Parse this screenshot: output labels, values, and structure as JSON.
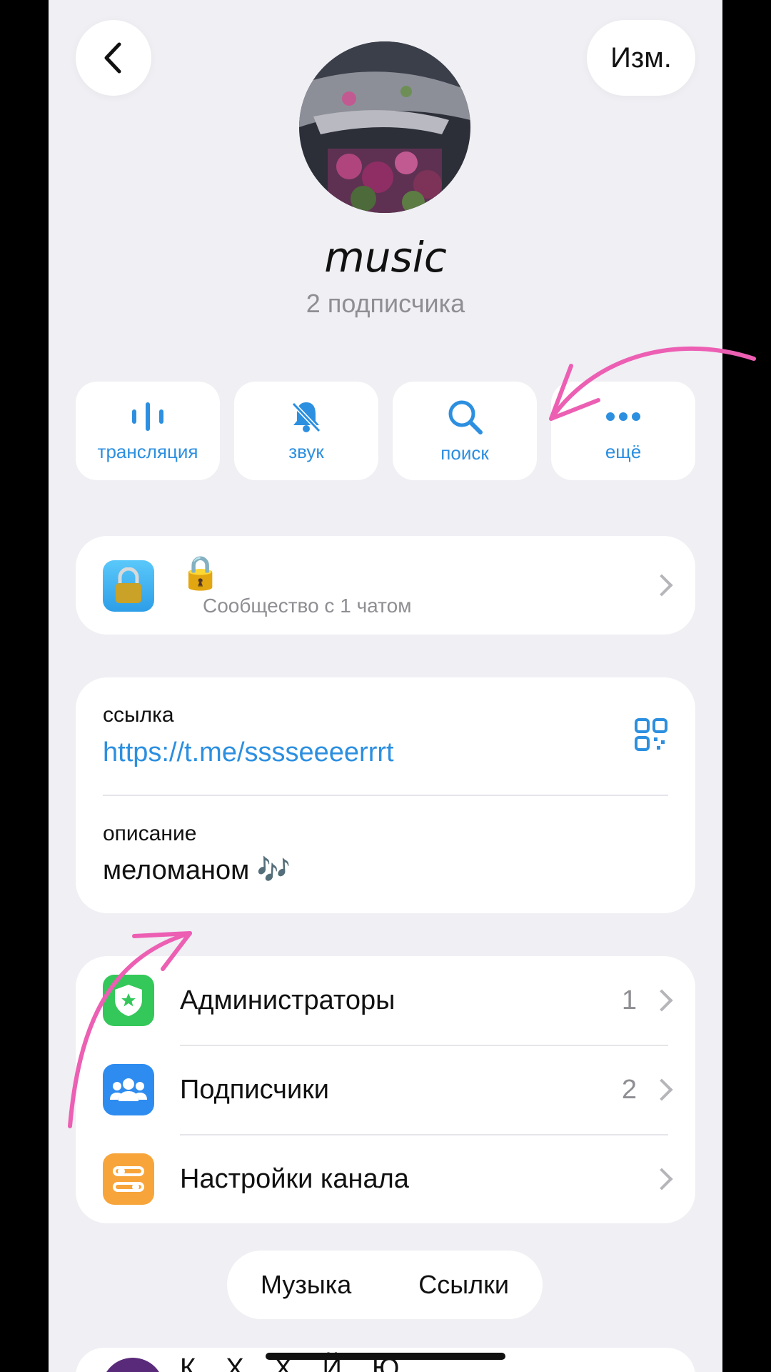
{
  "header": {
    "edit_label": "Изм."
  },
  "profile": {
    "name": "music",
    "subscribers": "2 подписчика"
  },
  "actions": [
    {
      "label": "трансляция",
      "icon": "broadcast-icon"
    },
    {
      "label": "звук",
      "icon": "bell-muted-icon"
    },
    {
      "label": "поиск",
      "icon": "search-icon"
    },
    {
      "label": "ещё",
      "icon": "more-icon"
    }
  ],
  "community": {
    "title_emoji": "🔒",
    "label": "Сообщество с 1 чатом"
  },
  "info": {
    "link_label": "ссылка",
    "link_value": "https://t.me/sssseeeerrrt",
    "description_label": "описание",
    "description_value": "меломаном 🎶"
  },
  "menu": [
    {
      "label": "Администраторы",
      "count": "1",
      "icon": "shield-icon",
      "color": "#34c759"
    },
    {
      "label": "Подписчики",
      "count": "2",
      "icon": "people-icon",
      "color": "#2e8cf0"
    },
    {
      "label": "Настройки канала",
      "count": "",
      "icon": "settings-sliders-icon",
      "color": "#f7a53a"
    }
  ],
  "tabs": [
    "Музыка",
    "Ссылки"
  ],
  "bottom_item": {
    "text": "К... Х... Х... Й... Ю"
  },
  "colors": {
    "accent": "#2c8fe0",
    "annotation_arrow": "#ec5fb3",
    "background": "#efeff4"
  }
}
